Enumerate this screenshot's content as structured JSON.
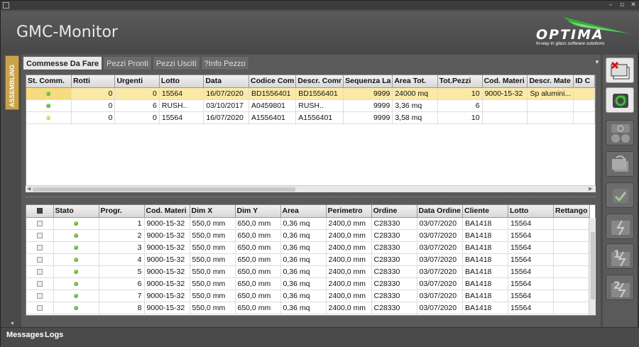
{
  "window": {
    "title_icon": "app-icon",
    "controls": [
      "–",
      "▫",
      "✕"
    ]
  },
  "header": {
    "app_title": "GMC-Monitor",
    "logo_text": "OPTIMA",
    "logo_tagline": "hi-way in glass software solutions"
  },
  "side_tab": {
    "label": "ASSEMBLING"
  },
  "tabs": [
    {
      "label": "Commesse Da Fare",
      "active": true
    },
    {
      "label": "Pezzi Pronti",
      "active": false
    },
    {
      "label": "Pezzi Usciti",
      "active": false
    },
    {
      "label": "?Info Pezzo",
      "active": false
    }
  ],
  "orders_table": {
    "columns": [
      "St. Comm.",
      "Rotti",
      "Urgenti",
      "Lotto",
      "Data",
      "Codice Com",
      "Descr. Comr",
      "Sequenza La",
      "Area Tot.",
      "Tot.Pezzi",
      "Cod. Materi",
      "Descr. Mate",
      "ID C"
    ],
    "rows": [
      {
        "status": "green",
        "rotti": "0",
        "urgenti": "0",
        "lotto": "15564",
        "data": "16/07/2020",
        "codice": "BD1556401",
        "descr": "BD1556401",
        "sequenza": "9999",
        "area": "24000 mq",
        "tot_pezzi": "10",
        "cod_mat": "9000-15-32",
        "descr_mat": "Sp alumini...",
        "id_c": "",
        "selected": true
      },
      {
        "status": "green",
        "rotti": "0",
        "urgenti": "6",
        "lotto": "RUSH..",
        "data": "03/10/2017",
        "codice": "A0459801",
        "descr": "RUSH..",
        "sequenza": "9999",
        "area": "3,36 mq",
        "tot_pezzi": "6",
        "cod_mat": "",
        "descr_mat": "",
        "id_c": "",
        "selected": false
      },
      {
        "status": "yellow",
        "rotti": "0",
        "urgenti": "0",
        "lotto": "15564",
        "data": "16/07/2020",
        "codice": "A1556401",
        "descr": "A1556401",
        "sequenza": "9999",
        "area": "3,58 mq",
        "tot_pezzi": "10",
        "cod_mat": "",
        "descr_mat": "",
        "id_c": "",
        "selected": false
      }
    ]
  },
  "pieces_table": {
    "columns": [
      "",
      "Stato",
      "Progr.",
      "Cod. Materi",
      "Dim X",
      "Dim Y",
      "Area",
      "Perimetro",
      "Ordine",
      "Data Ordine",
      "Cliente",
      "Lotto",
      "Rettango"
    ],
    "rows": [
      {
        "stato": "green",
        "progr": "1",
        "cod_mat": "9000-15-32",
        "dim_x": "550,0 mm",
        "dim_y": "650,0 mm",
        "area": "0,36 mq",
        "perimetro": "2400,0 mm",
        "ordine": "C28330",
        "data_ordine": "03/07/2020",
        "cliente": "BA1418",
        "lotto": "15564",
        "rettango": ""
      },
      {
        "stato": "green",
        "progr": "2",
        "cod_mat": "9000-15-32",
        "dim_x": "550,0 mm",
        "dim_y": "650,0 mm",
        "area": "0,36 mq",
        "perimetro": "2400,0 mm",
        "ordine": "C28330",
        "data_ordine": "03/07/2020",
        "cliente": "BA1418",
        "lotto": "15564",
        "rettango": ""
      },
      {
        "stato": "green",
        "progr": "3",
        "cod_mat": "9000-15-32",
        "dim_x": "550,0 mm",
        "dim_y": "650,0 mm",
        "area": "0,36 mq",
        "perimetro": "2400,0 mm",
        "ordine": "C28330",
        "data_ordine": "03/07/2020",
        "cliente": "BA1418",
        "lotto": "15564",
        "rettango": ""
      },
      {
        "stato": "green",
        "progr": "4",
        "cod_mat": "9000-15-32",
        "dim_x": "550,0 mm",
        "dim_y": "650,0 mm",
        "area": "0,36 mq",
        "perimetro": "2400,0 mm",
        "ordine": "C28330",
        "data_ordine": "03/07/2020",
        "cliente": "BA1418",
        "lotto": "15564",
        "rettango": ""
      },
      {
        "stato": "green",
        "progr": "5",
        "cod_mat": "9000-15-32",
        "dim_x": "550,0 mm",
        "dim_y": "650,0 mm",
        "area": "0,36 mq",
        "perimetro": "2400,0 mm",
        "ordine": "C28330",
        "data_ordine": "03/07/2020",
        "cliente": "BA1418",
        "lotto": "15564",
        "rettango": ""
      },
      {
        "stato": "green",
        "progr": "6",
        "cod_mat": "9000-15-32",
        "dim_x": "550,0 mm",
        "dim_y": "650,0 mm",
        "area": "0,36 mq",
        "perimetro": "2400,0 mm",
        "ordine": "C28330",
        "data_ordine": "03/07/2020",
        "cliente": "BA1418",
        "lotto": "15564",
        "rettango": ""
      },
      {
        "stato": "green",
        "progr": "7",
        "cod_mat": "9000-15-32",
        "dim_x": "550,0 mm",
        "dim_y": "650,0 mm",
        "area": "0,36 mq",
        "perimetro": "2400,0 mm",
        "ordine": "C28330",
        "data_ordine": "03/07/2020",
        "cliente": "BA1418",
        "lotto": "15564",
        "rettango": ""
      },
      {
        "stato": "green",
        "progr": "8",
        "cod_mat": "9000-15-32",
        "dim_x": "550,0 mm",
        "dim_y": "650,0 mm",
        "area": "0,36 mq",
        "perimetro": "2400,0 mm",
        "ordine": "C28330",
        "data_ordine": "03/07/2020",
        "cliente": "BA1418",
        "lotto": "15564",
        "rettango": ""
      }
    ]
  },
  "right_toolbar": [
    {
      "name": "cancel-icon",
      "enabled": true
    },
    {
      "name": "refresh-icon",
      "enabled": true
    },
    {
      "name": "power-icon",
      "enabled": false
    },
    {
      "name": "undo-icon",
      "enabled": false
    },
    {
      "name": "confirm-icon",
      "enabled": false
    },
    {
      "name": "break-icon",
      "enabled": false
    },
    {
      "name": "break-1-icon",
      "enabled": false
    },
    {
      "name": "break-2-icon",
      "enabled": false
    }
  ],
  "bottom_tabs": {
    "messages": "Messages",
    "logs": "Logs"
  },
  "colors": {
    "selected_row": "#fbe9a6",
    "active_tab": "#e8e8e8",
    "side_tab": "#c9a24a",
    "logo_accent": "#2fae3a"
  }
}
